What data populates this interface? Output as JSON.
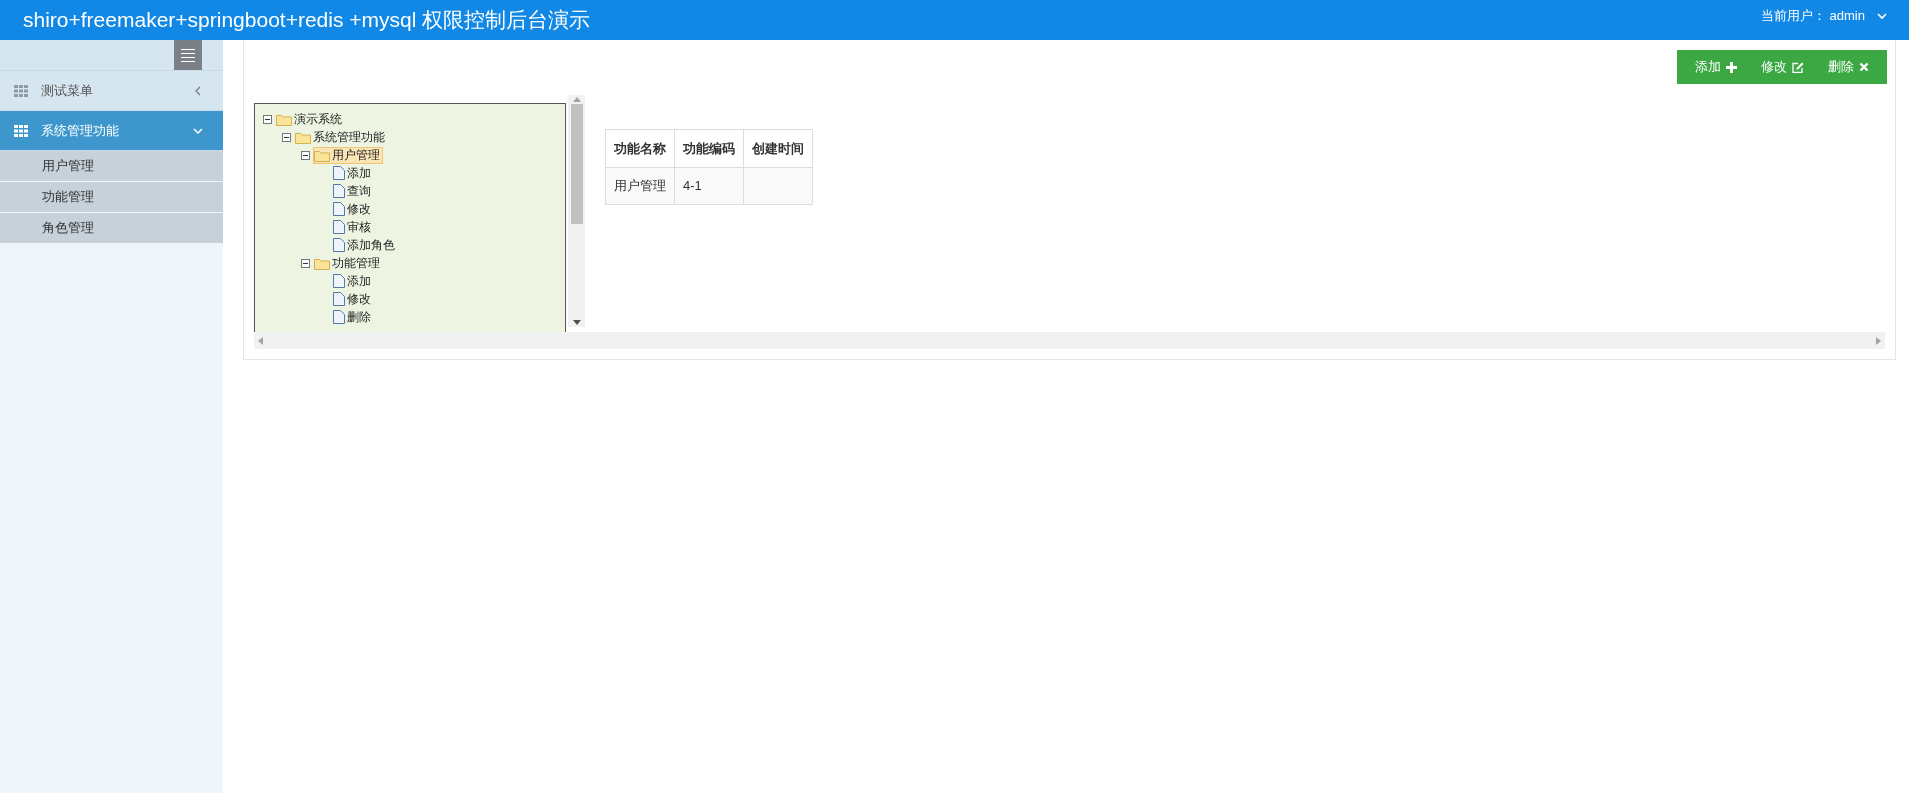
{
  "header": {
    "title": "shiro+freemaker+springboot+redis +mysql 权限控制后台演示",
    "user_label": "当前用户：",
    "user_name": "admin"
  },
  "sidebar": {
    "items": [
      {
        "label": "测试菜单",
        "expanded": false
      },
      {
        "label": "系统管理功能",
        "expanded": true,
        "children": [
          {
            "label": "用户管理"
          },
          {
            "label": "功能管理"
          },
          {
            "label": "角色管理"
          }
        ]
      }
    ]
  },
  "toolbar": {
    "buttons": [
      {
        "label": "添加",
        "kind": "add"
      },
      {
        "label": "修改",
        "kind": "edit"
      },
      {
        "label": "删除",
        "kind": "delete"
      }
    ]
  },
  "tree": [
    {
      "label": "演示系统",
      "expanded": true,
      "selected": false,
      "children": [
        {
          "label": "系统管理功能",
          "expanded": true,
          "selected": false,
          "children": [
            {
              "label": "用户管理",
              "expanded": true,
              "selected": true,
              "children": [
                {
                  "label": "添加",
                  "selected": false
                },
                {
                  "label": "查询",
                  "selected": false
                },
                {
                  "label": "修改",
                  "selected": false
                },
                {
                  "label": "审核",
                  "selected": false
                },
                {
                  "label": "添加角色",
                  "selected": false
                }
              ]
            },
            {
              "label": "功能管理",
              "expanded": true,
              "selected": false,
              "children": [
                {
                  "label": "添加",
                  "selected": false
                },
                {
                  "label": "修改",
                  "selected": false
                },
                {
                  "label": "删除",
                  "selected": false
                }
              ]
            }
          ]
        }
      ]
    }
  ],
  "table": {
    "columns": [
      "功能名称",
      "功能编码",
      "创建时间"
    ],
    "rows": [
      [
        "用户管理",
        "4-1",
        ""
      ]
    ]
  }
}
